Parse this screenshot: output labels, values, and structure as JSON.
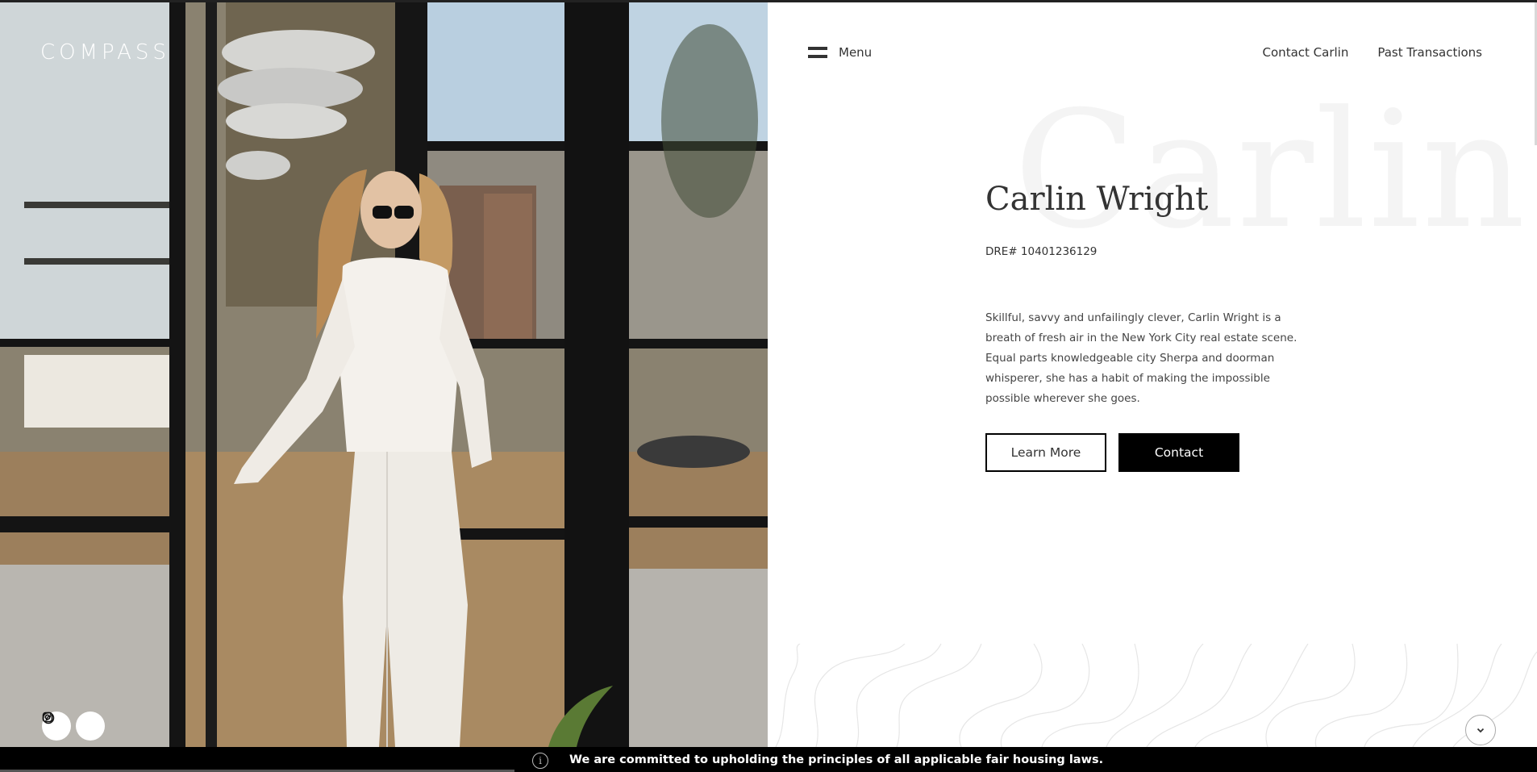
{
  "brand": {
    "logo_text": "COMPASS"
  },
  "header": {
    "menu_label": "Menu",
    "nav": [
      "Contact Carlin",
      "Past Transactions"
    ]
  },
  "hero": {
    "social": [
      {
        "icon": "instagram-icon"
      },
      {
        "icon": "compass-icon"
      }
    ]
  },
  "agent": {
    "background_word": "Carlin",
    "name": "Carlin Wright",
    "license": "DRE# 10401236129",
    "bio": "Skillful, savvy and unfailingly clever, Carlin Wright is a breath of fresh air in the New York City real estate scene. Equal parts knowledgeable city Sherpa and doorman whisperer, she has a habit of making the impossible possible wherever she goes."
  },
  "actions": {
    "learn_more": "Learn More",
    "contact": "Contact"
  },
  "scroll_icon": "chevron-down-icon",
  "footer": {
    "info_icon": "i",
    "notice": "We are committed to upholding the principles of all applicable fair housing laws."
  },
  "colors": {
    "primary": "#000000",
    "text": "#333333",
    "watermark": "#f4f4f4"
  }
}
